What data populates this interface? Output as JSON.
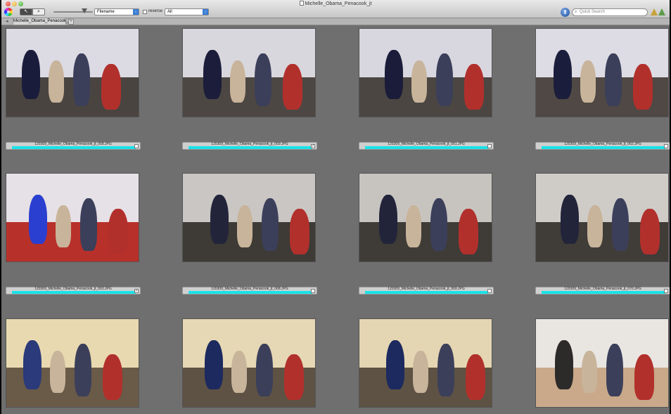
{
  "window": {
    "title": "Michelle_Obama_Penacook_jt"
  },
  "toolbar": {
    "sort_select": "Filename",
    "reverse_label": "reverse",
    "reverse_checked": false,
    "filter_select": "All",
    "search_placeholder": "Quick Search"
  },
  "tabs": {
    "folder_tab": "Michelle_Obama_Penacook_jt",
    "add_tab": "+"
  },
  "thumbnails": [
    {
      "filename": "120309_Michelle_Obama_Penacook_jt_058.JPG",
      "checked": false,
      "wall": "#dcdbe4",
      "floor": "#4a4440",
      "accent": "#1a1c3c"
    },
    {
      "filename": "120309_Michelle_Obama_Penacook_jt_059.JPG",
      "checked": true,
      "wall": "#d9d7de",
      "floor": "#4d4743",
      "accent": "#1b1d3a"
    },
    {
      "filename": "120309_Michelle_Obama_Penacook_jt_061.JPG",
      "checked": false,
      "wall": "#d8d7df",
      "floor": "#4b4642",
      "accent": "#1a1c3a"
    },
    {
      "filename": "120309_Michelle_Obama_Penacook_jt_062.JPG",
      "checked": false,
      "wall": "#dddce4",
      "floor": "#4f4844",
      "accent": "#1b1d3c"
    },
    {
      "filename": "120309_Michelle_Obama_Penacook_jt_063.JPG",
      "checked": true,
      "wall": "#e6e1e6",
      "floor": "#b8302a",
      "accent": "#2a3fd0"
    },
    {
      "filename": "120309_Michelle_Obama_Penacook_jt_068.JPG",
      "checked": false,
      "wall": "#c9c6c3",
      "floor": "#3e3a36",
      "accent": "#22243a"
    },
    {
      "filename": "120309_Michelle_Obama_Penacook_jt_069.JPG",
      "checked": false,
      "wall": "#c7c4c0",
      "floor": "#3f3b37",
      "accent": "#22243a"
    },
    {
      "filename": "120309_Michelle_Obama_Penacook_jt_070.JPG",
      "checked": false,
      "wall": "#cfccc8",
      "floor": "#403c38",
      "accent": "#22243a"
    },
    {
      "filename": "",
      "checked": false,
      "wall": "#e8d9b0",
      "floor": "#6a5a48",
      "accent": "#2a3a7a"
    },
    {
      "filename": "",
      "checked": false,
      "wall": "#e6d8b4",
      "floor": "#5e5244",
      "accent": "#1d2a60"
    },
    {
      "filename": "",
      "checked": false,
      "wall": "#e4d6b2",
      "floor": "#5d5243",
      "accent": "#1d2a60"
    },
    {
      "filename": "",
      "checked": false,
      "wall": "#e9e6e2",
      "floor": "#c9a98a",
      "accent": "#2d2a2a"
    }
  ],
  "icons": {
    "app_logo": "app-logo-icon",
    "view_pointer": "pointer-icon",
    "view_magnify": "magnifier-icon",
    "nav": "navigation-arrow-icon",
    "search": "search-icon"
  }
}
